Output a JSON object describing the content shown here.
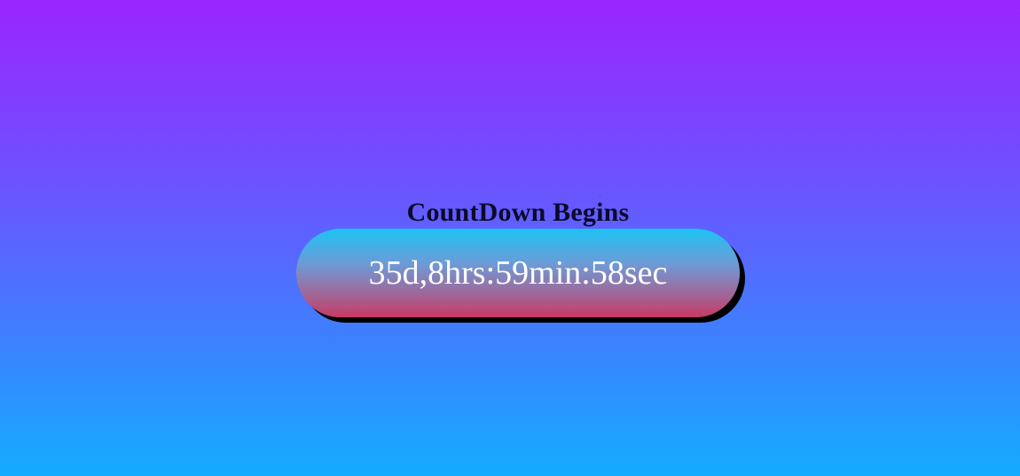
{
  "countdown": {
    "title": "CountDown Begins",
    "value": "35d,8hrs:59min:58sec"
  },
  "colors": {
    "background_top": "#9a25ff",
    "background_bottom": "#14acff",
    "pill_top": "#1cc4f4",
    "pill_bottom": "#c83a64",
    "pill_shadow": "#000000",
    "title_text": "#0a0a2a",
    "timer_text": "#ffffff"
  }
}
